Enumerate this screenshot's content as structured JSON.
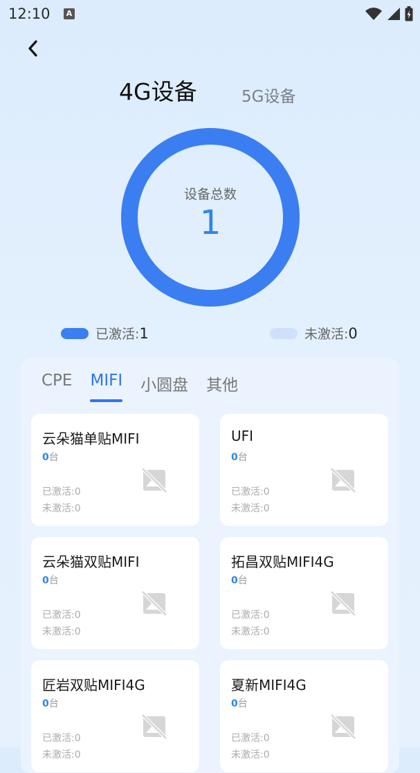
{
  "status_bar": {
    "time": "12:10",
    "notification_icon": "A"
  },
  "tabs": {
    "g4": "4G设备",
    "g5": "5G设备",
    "selected": "g4"
  },
  "summary": {
    "label": "设备总数",
    "total": "1",
    "activated_label": "已激活:",
    "activated_value": "1",
    "unactivated_label": "未激活:",
    "unactivated_value": "0",
    "activated_fraction": 1.0
  },
  "colors": {
    "accent": "#2e74f0",
    "ring": "#3b7ef1",
    "count": "#2e86e6",
    "inactive": "#cfe0fb"
  },
  "categories": {
    "items": [
      "CPE",
      "MIFI",
      "小圆盘",
      "其他"
    ],
    "selected_index": 1
  },
  "devices": [
    {
      "name": "云朵猫单贴MIFI",
      "count": "0",
      "unit": "台",
      "activated": "已激活:0",
      "unactivated": "未激活:0"
    },
    {
      "name": "UFI",
      "count": "0",
      "unit": "台",
      "activated": "已激活:0",
      "unactivated": "未激活:0"
    },
    {
      "name": "云朵猫双贴MIFI",
      "count": "0",
      "unit": "台",
      "activated": "已激活:0",
      "unactivated": "未激活:0"
    },
    {
      "name": "拓昌双贴MIFI4G",
      "count": "0",
      "unit": "台",
      "activated": "已激活:0",
      "unactivated": "未激活:0"
    },
    {
      "name": "匠岩双贴MIFI4G",
      "count": "0",
      "unit": "台",
      "activated": "已激活:0",
      "unactivated": "未激活:0"
    },
    {
      "name": "夏新MIFI4G",
      "count": "0",
      "unit": "台",
      "activated": "已激活:0",
      "unactivated": "未激活:0"
    }
  ]
}
